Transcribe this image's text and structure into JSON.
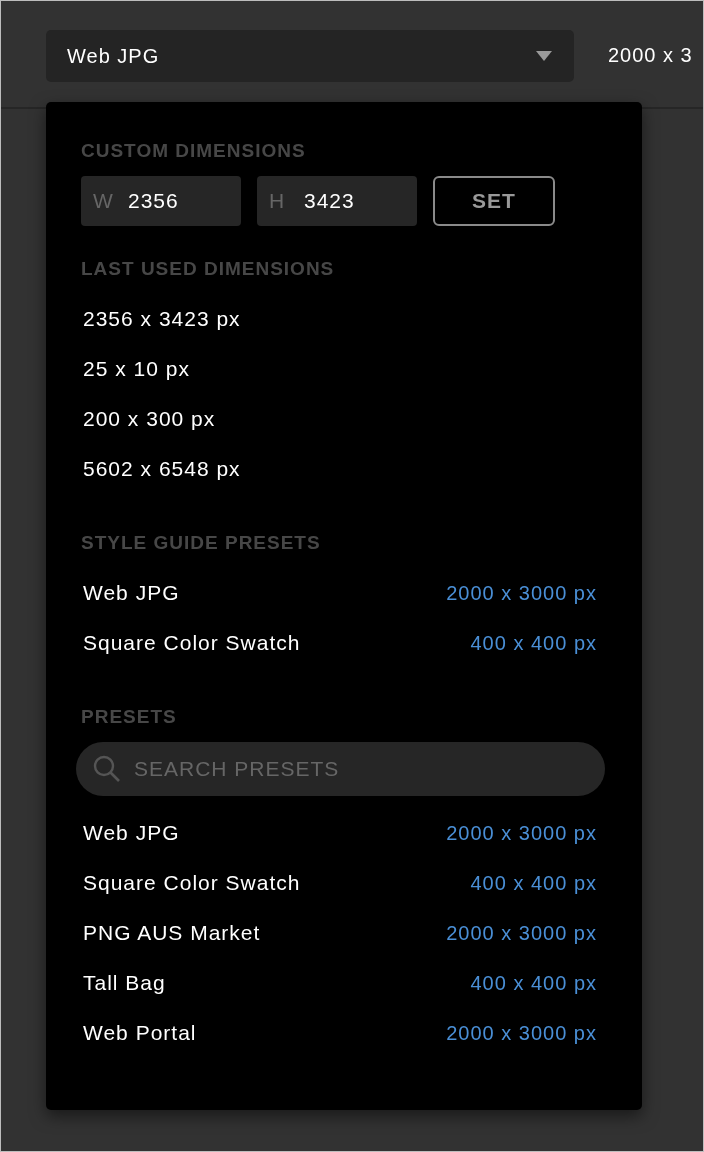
{
  "format_select": {
    "value": "Web JPG"
  },
  "current_size": "2000 x 3",
  "popup": {
    "custom": {
      "heading": "CUSTOM DIMENSIONS",
      "width": {
        "label": "W",
        "value": "2356"
      },
      "height": {
        "label": "H",
        "value": "3423"
      },
      "set_button": "SET"
    },
    "last_used": {
      "heading": "LAST USED DIMENSIONS",
      "items": [
        "2356 x 3423 px",
        "25 x 10 px",
        "200 x 300 px",
        "5602 x 6548 px"
      ]
    },
    "style_guide": {
      "heading": "STYLE GUIDE PRESETS",
      "items": [
        {
          "name": "Web JPG",
          "size": "2000 x 3000 px"
        },
        {
          "name": "Square Color Swatch",
          "size": "400 x 400 px"
        }
      ]
    },
    "presets": {
      "heading": "PRESETS",
      "search": {
        "placeholder": "SEARCH PRESETS"
      },
      "items": [
        {
          "name": "Web JPG",
          "size": "2000 x 3000 px"
        },
        {
          "name": "Square Color Swatch",
          "size": "400 x 400 px"
        },
        {
          "name": "PNG AUS Market",
          "size": "2000 x 3000 px"
        },
        {
          "name": "Tall Bag",
          "size": "400 x 400 px"
        },
        {
          "name": "Web Portal",
          "size": "2000 x 3000 px"
        }
      ]
    }
  }
}
